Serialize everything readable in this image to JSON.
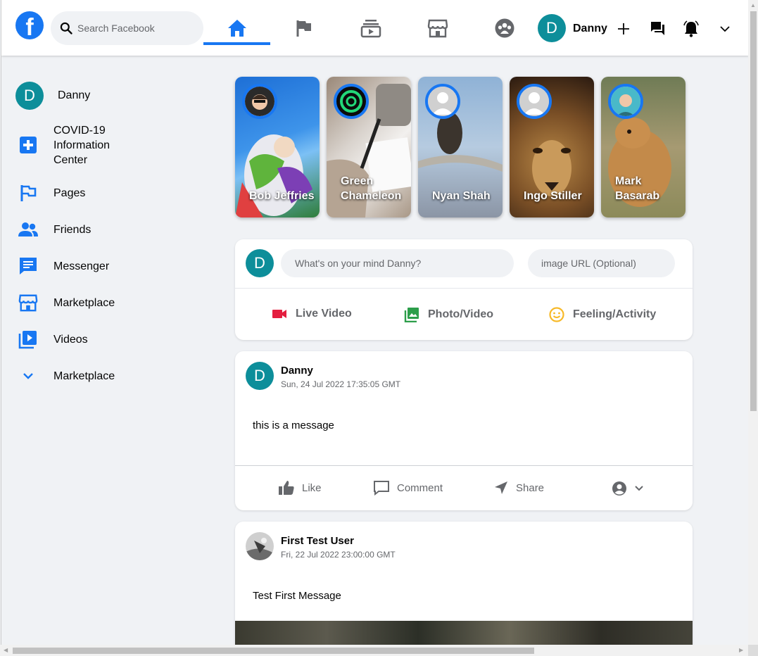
{
  "header": {
    "logo_letter": "f",
    "search_placeholder": "Search Facebook",
    "nav_icons": [
      "home-icon",
      "flag-icon",
      "watch-icon",
      "marketplace-icon",
      "groups-icon"
    ],
    "user_initial": "D",
    "user_name": "Danny",
    "right_icons": [
      "plus-icon",
      "messenger-icon",
      "bell-icon",
      "chevron-down-icon"
    ]
  },
  "sidebar": {
    "user_initial": "D",
    "user_name": "Danny",
    "items": [
      {
        "label": "COVID-19\nInformation\nCenter",
        "icon": "covid-plus-icon"
      },
      {
        "label": "Pages",
        "icon": "flag-icon"
      },
      {
        "label": "Friends",
        "icon": "friends-icon"
      },
      {
        "label": "Messenger",
        "icon": "messenger-icon"
      },
      {
        "label": "Marketplace",
        "icon": "marketplace-icon"
      },
      {
        "label": "Videos",
        "icon": "video-icon"
      },
      {
        "label": "Marketplace",
        "icon": "chevron-down-icon"
      }
    ]
  },
  "stories": [
    {
      "name": "Bob Jeffries"
    },
    {
      "name": "Green\nChameleon"
    },
    {
      "name": "Nyan Shah"
    },
    {
      "name": "Ingo Stiller"
    },
    {
      "name": "Mark\nBasarab"
    }
  ],
  "composer": {
    "user_initial": "D",
    "placeholder": "What's on your mind Danny?",
    "url_placeholder": "image URL (Optional)",
    "buttons": [
      {
        "label": "Live Video",
        "color": "#f02849"
      },
      {
        "label": "Photo/Video",
        "color": "#45bd62"
      },
      {
        "label": "Feeling/Activity",
        "color": "#f7b928"
      }
    ]
  },
  "posts": [
    {
      "user_initial": "D",
      "user_name": "Danny",
      "timestamp": "Sun, 24 Jul 2022 17:35:05 GMT",
      "message": "this is a message",
      "actions": [
        "Like",
        "Comment",
        "Share"
      ]
    },
    {
      "user_name": "First Test User",
      "timestamp": "Fri, 22 Jul 2022 23:00:00 GMT",
      "message": "Test First Message"
    }
  ],
  "colors": {
    "brand": "#1877f2",
    "avatar": "#0d8e9a",
    "background": "#f0f2f5"
  }
}
